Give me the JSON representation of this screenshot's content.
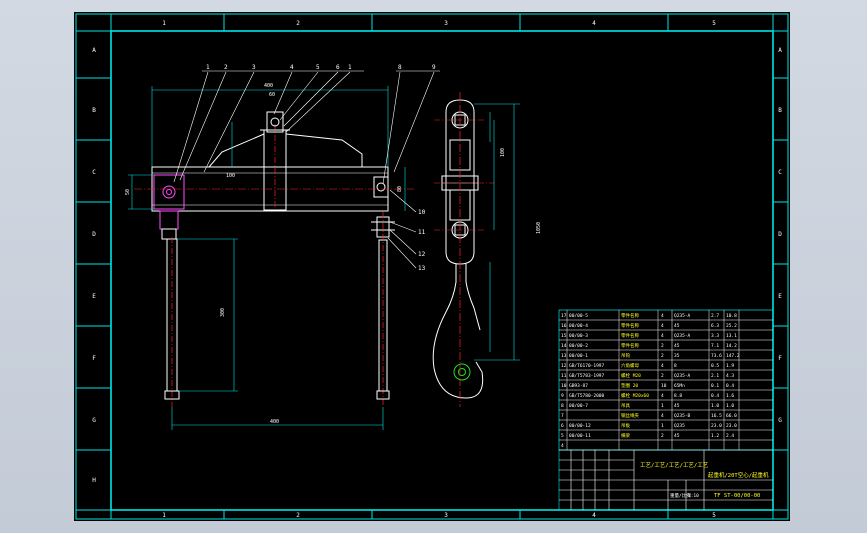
{
  "title_block": {
    "drawing_name": "起重机/20T空心/起重机",
    "drawing_no": "TF ST-00/00-00",
    "center_text": "工艺/工艺/工艺/工艺/工艺",
    "scale": "1:10",
    "weight": "重量/比例"
  },
  "balloons": [
    "1",
    "2",
    "3",
    "4",
    "5",
    "6",
    "7",
    "8",
    "9",
    "10",
    "11",
    "12",
    "13"
  ],
  "zone_letters": [
    "A",
    "B",
    "C",
    "D",
    "E",
    "F",
    "G",
    "H"
  ],
  "zone_numbers": [
    "1",
    "2",
    "3",
    "4",
    "5",
    "6"
  ],
  "dimensions": {
    "span": "400",
    "hook_height": "300",
    "top_width": "400",
    "total": "1050",
    "left_h": "50",
    "beam": "100",
    "d1": "60",
    "d2": "80"
  },
  "bom": [
    {
      "no": "17",
      "code": "00/00-5",
      "name": "零件名称",
      "qty": "4",
      "mat": "Q235-A",
      "w1": "2.7",
      "w2": "10.8"
    },
    {
      "no": "16",
      "code": "00/00-4",
      "name": "零件名称",
      "qty": "4",
      "mat": "45",
      "w1": "6.3",
      "w2": "25.2"
    },
    {
      "no": "15",
      "code": "00/00-3",
      "name": "零件名称",
      "qty": "4",
      "mat": "Q235-A",
      "w1": "3.3",
      "w2": "13.1"
    },
    {
      "no": "14",
      "code": "00/00-2",
      "name": "零件名称",
      "qty": "2",
      "mat": "45",
      "w1": "7.1",
      "w2": "14.2"
    },
    {
      "no": "13",
      "code": "00/00-1",
      "name": "吊钩",
      "qty": "2",
      "mat": "35",
      "w1": "73.6",
      "w2": "147.2"
    },
    {
      "no": "12",
      "code": "GB/T6170-1997",
      "name": "六角螺母",
      "qty": "4",
      "mat": "8",
      "w1": "0.5",
      "w2": "1.9"
    },
    {
      "no": "11",
      "code": "GB/T5783-1997",
      "name": "螺栓 M20",
      "qty": "2",
      "mat": "Q235-A",
      "w1": "2.1",
      "w2": "4.3"
    },
    {
      "no": "10",
      "code": "GB93-87",
      "name": "垫圈 20",
      "qty": "10",
      "mat": "65Mn",
      "w1": "0.1",
      "w2": "0.4"
    },
    {
      "no": "9",
      "code": "GB/T5780-2000",
      "name": "螺栓 M20x60",
      "qty": "4",
      "mat": "8.8",
      "w1": "0.4",
      "w2": "1.6"
    },
    {
      "no": "8",
      "code": "00/00-7",
      "name": "吊具",
      "qty": "1",
      "mat": "45",
      "w1": "1.0",
      "w2": "1.0"
    },
    {
      "no": "7",
      "code": "",
      "name": "钢丝绳夹",
      "qty": "4",
      "mat": "Q235-B",
      "w1": "16.5",
      "w2": "66.0"
    },
    {
      "no": "6",
      "code": "00/00-12",
      "name": "吊板",
      "qty": "1",
      "mat": "Q235",
      "w1": "23.0",
      "w2": "23.0"
    },
    {
      "no": "5",
      "code": "00/00-11",
      "name": "横梁",
      "qty": "2",
      "mat": "45",
      "w1": "1.2",
      "w2": "2.4"
    },
    {
      "no": "4",
      "code": "",
      "name": "",
      "qty": "",
      "mat": "",
      "w1": "",
      "w2": ""
    }
  ],
  "colors": {
    "frame": "#00e5e5",
    "line": "#ffffff",
    "red": "#ff2020",
    "magenta": "#ff4aff",
    "green": "#20e020",
    "yellow": "#ffff20"
  }
}
